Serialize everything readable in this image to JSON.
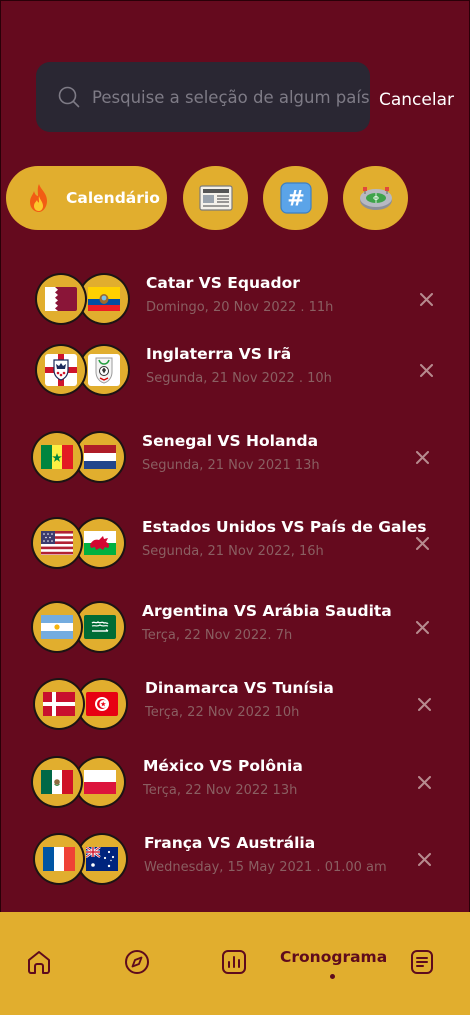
{
  "search": {
    "placeholder": "Pesquise a seleção de algum país",
    "cancel_label": "Cancelar"
  },
  "categories": [
    {
      "label": "Calendário",
      "icon": "fire-icon"
    },
    {
      "label": "",
      "icon": "newspaper-icon"
    },
    {
      "label": "",
      "icon": "hashtag-icon"
    },
    {
      "label": "",
      "icon": "stadium-icon"
    }
  ],
  "matches": [
    {
      "title": "Catar VS Equador",
      "date": "Domingo, 20 Nov 2022 . 11h",
      "flag_a": "qatar-flag-icon",
      "flag_b": "ecuador-flag-icon"
    },
    {
      "title": "Inglaterra VS Irã",
      "date": "Segunda, 21 Nov 2022 . 10h",
      "flag_a": "england-crest-icon",
      "flag_b": "iran-crest-icon"
    },
    {
      "title": "Senegal VS Holanda",
      "date": "Segunda, 21 Nov 2021 13h",
      "flag_a": "senegal-flag-icon",
      "flag_b": "netherlands-flag-icon"
    },
    {
      "title": "Estados Unidos VS  País de Gales",
      "date": "Segunda, 21 Nov 2022, 16h",
      "flag_a": "usa-flag-icon",
      "flag_b": "wales-flag-icon"
    },
    {
      "title": "Argentina VS Arábia Saudita",
      "date": "Terça, 22 Nov 2022. 7h",
      "flag_a": "argentina-flag-icon",
      "flag_b": "saudi-arabia-flag-icon"
    },
    {
      "title": "Dinamarca VS Tunísia",
      "date": "Terça, 22 Nov 2022 10h",
      "flag_a": "denmark-flag-icon",
      "flag_b": "tunisia-flag-icon"
    },
    {
      "title": "México VS Polônia",
      "date": "Terça, 22 Nov 2022 13h",
      "flag_a": "mexico-flag-icon",
      "flag_b": "poland-flag-icon"
    },
    {
      "title": "França VS Austrália",
      "date": "Wednesday, 15 May 2021 . 01.00 am",
      "flag_a": "france-flag-icon",
      "flag_b": "australia-flag-icon"
    }
  ],
  "nav": {
    "items": [
      "home-icon",
      "compass-icon",
      "chart-icon",
      "schedule",
      "notes-icon"
    ],
    "active_label": "Cronograma"
  },
  "colors": {
    "background": "#650a1e",
    "accent": "#e1ae2e",
    "search_bg": "#2a2733",
    "date_text": "#8a5f62",
    "nav_text": "#5e0b1d"
  }
}
